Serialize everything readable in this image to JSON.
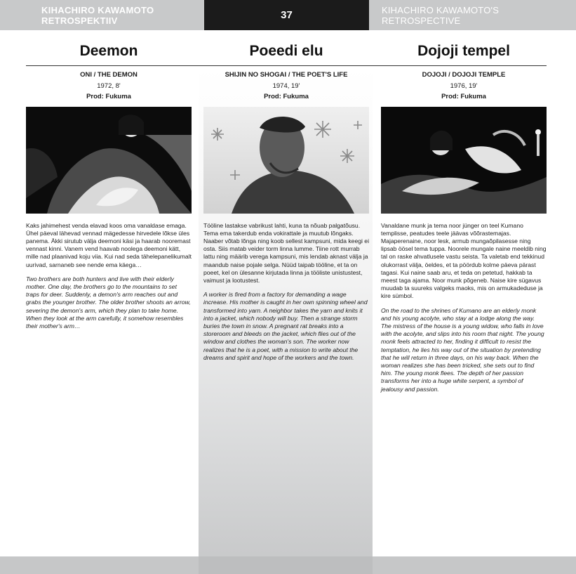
{
  "header": {
    "left_title": "KIHACHIRO KAWAMOTO RETROSPEKTIIV",
    "page_number": "37",
    "right_title": "KIHACHIRO KAWAMOTO'S RETROSPECTIVE"
  },
  "films": [
    {
      "title": "Deemon",
      "original_title": "ONI / THE DEMON",
      "year_length": "1972, 8'",
      "producer": "Prod: Fukuma",
      "estonian_text": "Kaks jahimehest venda elavad koos oma vanaldase emaga. Ühel päeval lähevad vennad mägedesse hirvedele lõkse üles panema. Äkki sirutub välja deemoni käsi ja haarab nooremast vennast kinni. Vanem vend haavab noolega deemoni kätt, mille nad plaanivad koju viia. Kui nad seda tähelepanelikumalt uurivad, sarnaneb see nende ema käega…",
      "english_text": "Two brothers are both hunters and live with their elderly mother. One day, the brothers go to the mountains to set traps for deer. Suddenly, a demon's arm reaches out and grabs the younger brother. The older brother shoots an arrow, severing the demon's arm, which they plan to take home. When they look at the arm carefully, it somehow resembles their mother's arm…"
    },
    {
      "title": "Poeedi elu",
      "original_title": "SHIJIN NO SHOGAI / THE POET'S LIFE",
      "year_length": "1974, 19'",
      "producer": "Prod: Fukuma",
      "estonian_text": "Tööline lastakse vabrikust lahti, kuna ta nõuab palgatõusu. Tema ema takerdub enda vokirattale ja muutub lõngaks. Naaber võtab lõnga ning koob sellest kampsuni, mida keegi ei osta. Siis matab veider torm linna lumme. Tiine rott murrab lattu ning määrib verega kampsuni, mis lendab aknast välja ja maandub naise pojale selga. Nüüd taipab tööline, et ta on poeet, kel on ülesanne kirjutada linna ja tööliste unistustest, vaimust ja lootustest.",
      "english_text": "A worker is fired from a factory for demanding a wage increase. His mother is caught in her own spinning wheel and transformed into yarn. A neighbor takes the yarn and knits it into a jacket, which nobody will buy. Then a strange storm buries the town in snow. A pregnant rat breaks into a storeroom and bleeds on the jacket, which flies out of the window and clothes the woman's son. The worker now realizes that he is a poet, with a mission to write about the dreams and spirit and hope of the workers and the town."
    },
    {
      "title": "Dojoji tempel",
      "original_title": "DOJOJI / DOJOJI TEMPLE",
      "year_length": "1976, 19'",
      "producer": "Prod: Fukuma",
      "estonian_text": "Vanaldane munk ja tema noor jünger on teel Kumano templisse, peatudes teele jäävas võõrastemajas. Majaperenaine, noor lesk, armub mungaõpilasesse ning lipsab öösel tema tuppa. Noorele mungale naine meeldib ning tal on raske ahvatlusele vastu seista. Ta valetab end tekkinud olukorrast välja, öeldes, et ta pöördub kolme päeva pärast tagasi. Kui naine saab aru, et teda on petetud, hakkab ta meest taga ajama. Noor munk põgeneb. Naise kire sügavus muudab ta suureks valgeks maoks, mis on armukadeduse ja kire sümbol.",
      "english_text": "On the road to the shrines of Kumano are an elderly monk and his young acolyte, who stay at a lodge along the way. The mistress of the house is a young widow, who falls in love with the acolyte, and slips into his room that night. The young monk feels attracted to her, finding it difficult to resist the temptation, he lies his way out of the situation by pretending that he will return in three days, on his way back. When the woman realizes she has been tricked, she sets out to find him. The young monk flees. The depth of her passion transforms her into a huge white serpent, a symbol of jealousy and passion."
    }
  ]
}
